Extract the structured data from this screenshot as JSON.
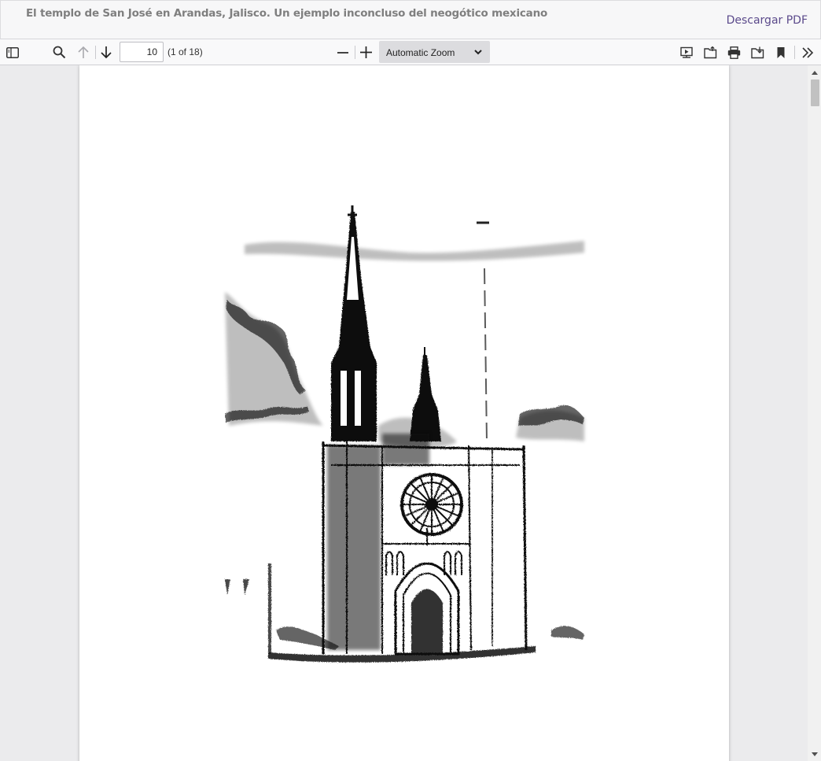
{
  "header": {
    "title": "El templo de San José en Arandas, Jalisco. Un ejemplo inconcluso del neogótico mexicano",
    "download_label": "Descargar PDF"
  },
  "toolbar": {
    "page_number": "10",
    "page_count": "(1 of 18)",
    "zoom": {
      "selected": "Automatic Zoom"
    },
    "icons": [
      "sidebar-toggle-icon",
      "search-icon",
      "previous-page-icon",
      "next-page-icon",
      "zoom-out-icon",
      "zoom-in-icon",
      "presentation-mode-icon",
      "open-file-icon",
      "print-icon",
      "download-icon",
      "bookmark-icon",
      "tools-icon"
    ]
  },
  "viewer": {
    "image": "gothic-church-ink-sketch"
  },
  "colors": {
    "link": "#5b4a8b",
    "viewer_background": "#ebebed",
    "toolbar_background": "#f9f9fa"
  }
}
